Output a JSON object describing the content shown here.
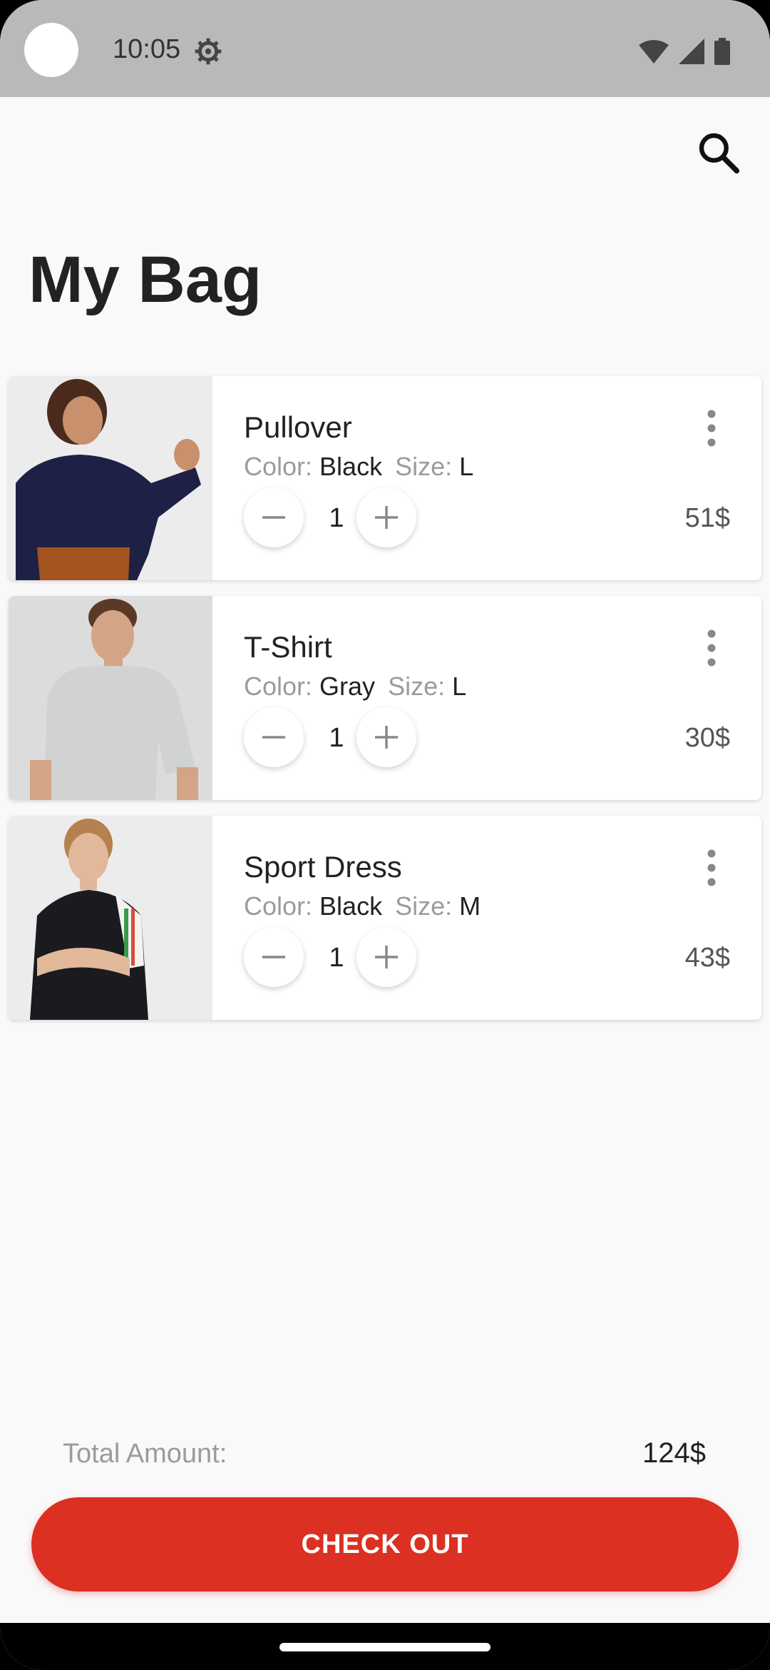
{
  "status_bar": {
    "time": "10:05"
  },
  "header": {
    "title": "My Bag"
  },
  "labels": {
    "color": "Color:",
    "size": "Size:"
  },
  "items": [
    {
      "name": "Pullover",
      "color": "Black",
      "size": "L",
      "quantity": "1",
      "price": "51$"
    },
    {
      "name": "T-Shirt",
      "color": "Gray",
      "size": "L",
      "quantity": "1",
      "price": "30$"
    },
    {
      "name": "Sport Dress",
      "color": "Black",
      "size": "M",
      "quantity": "1",
      "price": "43$"
    }
  ],
  "summary": {
    "total_label": "Total Amount:",
    "total_value": "124$"
  },
  "checkout": {
    "label": "CHECK OUT"
  },
  "colors": {
    "accent": "#db3022",
    "background": "#f9f9f9",
    "status_bar": "#b9b9b9"
  },
  "icons": [
    "settings-gear-icon",
    "wifi-icon",
    "cell-signal-icon",
    "battery-icon",
    "search-icon",
    "minus-icon",
    "plus-icon",
    "more-vertical-icon"
  ]
}
